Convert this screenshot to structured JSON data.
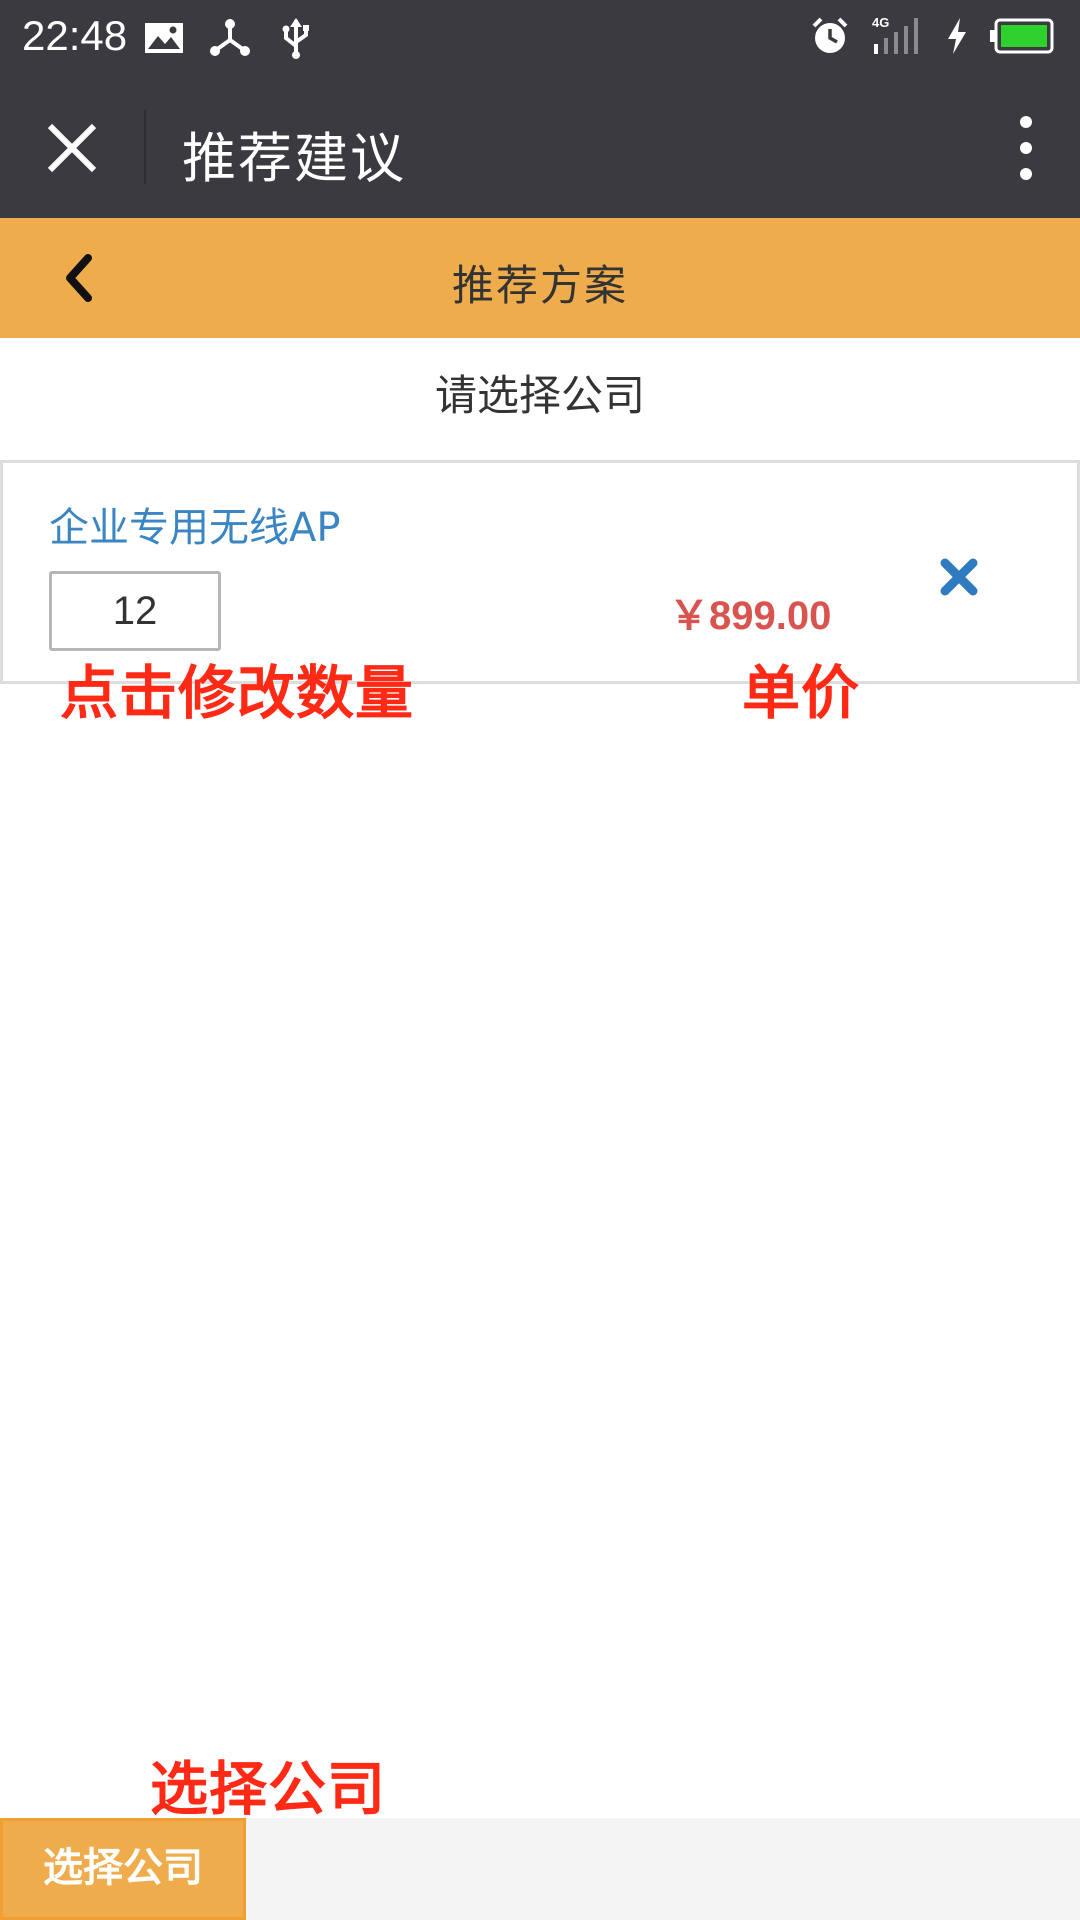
{
  "status_bar": {
    "time": "22:48",
    "network": "4G",
    "icons": [
      "image-icon",
      "share-icon",
      "usb-icon",
      "alarm-icon",
      "signal-icon",
      "charging-icon",
      "battery-icon"
    ]
  },
  "title_bar": {
    "title": "推荐建议"
  },
  "sub_header": {
    "title": "推荐方案"
  },
  "company_prompt": "请选择公司",
  "product": {
    "name": "企业专用无线AP",
    "quantity": "12",
    "price": "￥899.00"
  },
  "annotations": {
    "quantity_hint": "点击修改数量",
    "price_hint": "单价",
    "company_hint": "选择公司"
  },
  "bottom_bar": {
    "select_company_label": "选择公司"
  },
  "colors": {
    "dark_bar": "#3a3a40",
    "accent_orange": "#efac4c",
    "link_blue": "#3b86c2",
    "price_red": "#d9534f",
    "annotation_red": "#ff2a16"
  }
}
